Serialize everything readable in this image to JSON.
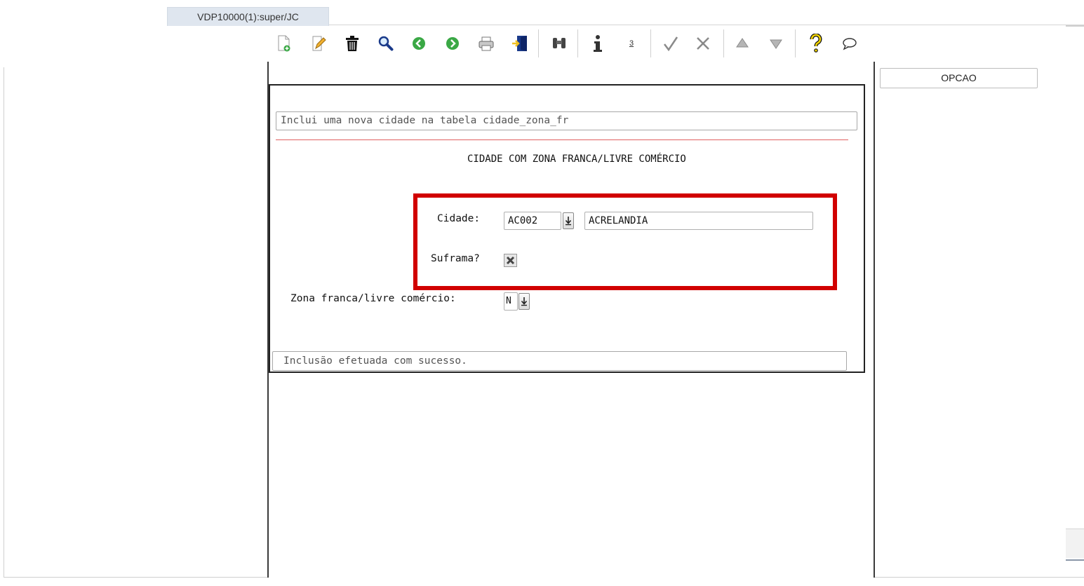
{
  "tab": {
    "label": "VDP10000(1):super/JC"
  },
  "toolbar": {
    "buttons": [
      {
        "name": "new-document-icon",
        "title": "Incluir"
      },
      {
        "name": "edit-icon",
        "title": "Modificar"
      },
      {
        "name": "trash-icon",
        "title": "Excluir"
      },
      {
        "name": "search-icon",
        "title": "Consultar"
      },
      {
        "name": "previous-icon",
        "title": "Anterior"
      },
      {
        "name": "next-icon",
        "title": "Seguinte"
      },
      {
        "name": "print-icon",
        "title": "Listar"
      },
      {
        "name": "exit-icon",
        "title": "Fim"
      },
      {
        "name": "binoculars-icon",
        "title": "Localizar"
      },
      {
        "name": "info-icon",
        "title": "Informar"
      },
      {
        "name": "sequence-icon",
        "title": "Sequencia"
      },
      {
        "name": "confirm-check-icon",
        "title": "Confirmar"
      },
      {
        "name": "cancel-x-icon",
        "title": "Cancelar"
      },
      {
        "name": "scroll-up-icon",
        "title": "Acima"
      },
      {
        "name": "scroll-down-icon",
        "title": "Abaixo"
      },
      {
        "name": "help-icon",
        "title": "Ajuda"
      },
      {
        "name": "chat-bubble-icon",
        "title": "Mensagem"
      }
    ],
    "sequence_number": "3"
  },
  "form": {
    "info_text": "Inclui uma nova cidade na tabela cidade_zona_fr",
    "title": "CIDADE COM ZONA FRANCA/LIVRE COMÉRCIO",
    "cidade_label": "Cidade:",
    "cidade_code": "AC002",
    "cidade_name": "ACRELANDIA",
    "suframa_label": "Suframa?",
    "suframa_checked": true,
    "zona_label": "Zona franca/livre comércio:",
    "zona_value": "N",
    "status_text": "Inclusão efetuada com sucesso."
  },
  "side": {
    "opcao_label": "OPCAO"
  },
  "colors": {
    "highlight": "#d10000",
    "tab_bg": "#dfe6ef",
    "accent_green": "#3aa845"
  }
}
